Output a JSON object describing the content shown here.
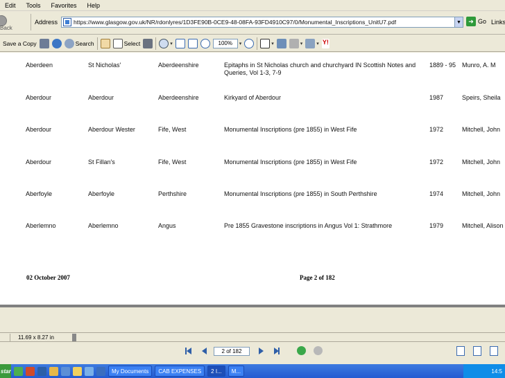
{
  "menu": [
    "Edit",
    "Tools",
    "Favorites",
    "Help"
  ],
  "address_bar": {
    "back_label": "Back",
    "label": "Address",
    "url": "https://www.glasgow.gov.uk/NR/rdonlyres/1D3FE90B-0CE9-48-08FA-93FD4910C97/0/Monumental_Inscriptions_UnitU7.pdf",
    "go_label": "Go",
    "links_label": "Links"
  },
  "toolbar": {
    "save_label": "Save a Copy",
    "search_label": "Search",
    "select_label": "Select",
    "zoom_value": "100%"
  },
  "document": {
    "records": [
      {
        "place": "Aberdeen",
        "parish": "St Nicholas'",
        "county": "Aberdeenshire",
        "title": "Epitaphs in St Nicholas church and churchyard IN Scottish Notes and Queries, Vol 1-3, 7-9",
        "year": "1889 - 95",
        "author": "Munro, A. M"
      },
      {
        "place": "Aberdour",
        "parish": "Aberdour",
        "county": "Aberdeenshire",
        "title": "Kirkyard of Aberdour",
        "year": "1987",
        "author": "Speirs, Sheila"
      },
      {
        "place": "Aberdour",
        "parish": "Aberdour Wester",
        "county": "Fife, West",
        "title": "Monumental Inscriptions (pre 1855) in West Fife",
        "year": "1972",
        "author": "Mitchell, John"
      },
      {
        "place": "Aberdour",
        "parish": "St Fillan's",
        "county": "Fife, West",
        "title": "Monumental Inscriptions (pre 1855) in West Fife",
        "year": "1972",
        "author": "Mitchell, John"
      },
      {
        "place": "Aberfoyle",
        "parish": "Aberfoyle",
        "county": "Perthshire",
        "title": "Monumental Inscriptions (pre 1855) in South Perthshire",
        "year": "1974",
        "author": "Mitchell, John"
      },
      {
        "place": "Aberlemno",
        "parish": "Aberlemno",
        "county": "Angus",
        "title": "Pre 1855 Gravestone inscriptions in Angus Vol 1: Strathmore",
        "year": "1979",
        "author": "Mitchell, Alison"
      }
    ],
    "footer_date": "02 October 2007",
    "footer_page": "Page 2 of 182"
  },
  "status": {
    "page_size": "11.69 x 8.27 in",
    "page_field": "2 of 182"
  },
  "taskbar": {
    "start_label": "start",
    "tasks": [
      "My Documents",
      "CAB EXPENSES",
      "2 I...",
      "M..."
    ],
    "clock": "14:5"
  }
}
